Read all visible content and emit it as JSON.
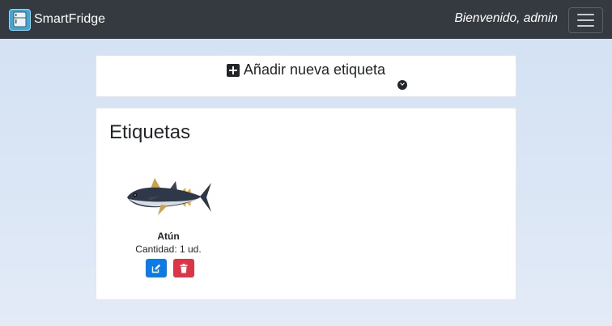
{
  "navbar": {
    "brand_name": "SmartFridge",
    "brand_icon": "fridge-icon",
    "welcome_text": "Bienvenido, admin",
    "menu_icon": "hamburger-menu-icon"
  },
  "add_label": {
    "title": "Añadir nueva etiqueta",
    "icon": "plus-square-icon",
    "toggle_icon": "chevron-down-circle-icon"
  },
  "labels_section": {
    "title": "Etiquetas",
    "items": [
      {
        "name": "Atún",
        "quantity": "Cantidad: 1 ud.",
        "image": "tuna-fish-image",
        "edit_icon": "edit-icon",
        "delete_icon": "trash-icon"
      }
    ]
  },
  "colors": {
    "navbar_bg": "#343a40",
    "edit_button": "#0d7be6",
    "delete_button": "#dc3545",
    "page_bg": "#d3e1f3"
  }
}
